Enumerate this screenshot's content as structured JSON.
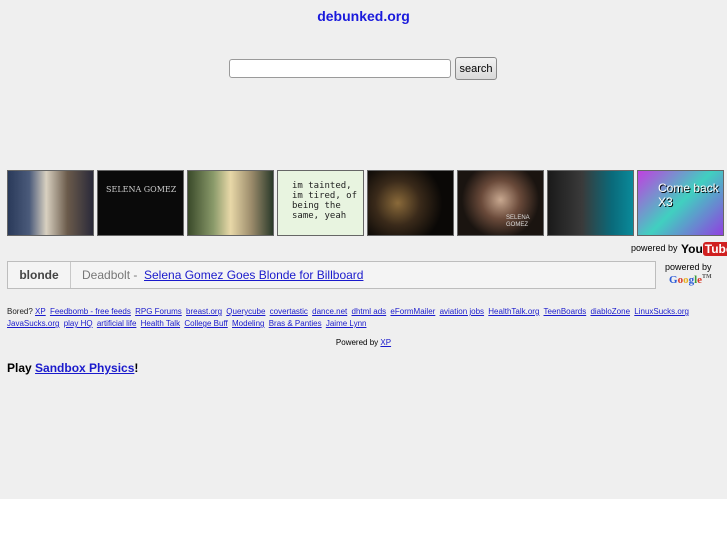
{
  "header": {
    "site_title": "debunked.org"
  },
  "search": {
    "value": "",
    "placeholder": "",
    "button_label": "search"
  },
  "thumbnails": [
    {
      "alt": "video-thumbnail-1",
      "overlay": ""
    },
    {
      "alt": "video-thumbnail-2",
      "overlay": "SELENA GOMEZ"
    },
    {
      "alt": "video-thumbnail-3",
      "overlay": ""
    },
    {
      "alt": "video-thumbnail-4",
      "overlay": "im tainted, im tired, of being the same, yeah"
    },
    {
      "alt": "video-thumbnail-5",
      "overlay": ""
    },
    {
      "alt": "video-thumbnail-6",
      "overlay": "SELENA GOMEZ"
    },
    {
      "alt": "video-thumbnail-7",
      "overlay": ""
    },
    {
      "alt": "video-thumbnail-8",
      "overlay": "Come back X3"
    }
  ],
  "youtube": {
    "powered_by": "powered by",
    "logo_you": "You",
    "logo_tube": "Tube"
  },
  "video": {
    "tag": "blonde",
    "author": "Deadbolt -",
    "title": "Selena Gomez Goes Blonde for Billboard"
  },
  "google": {
    "powered_by": "powered by",
    "logo": [
      "G",
      "o",
      "o",
      "g",
      "l",
      "e"
    ],
    "tm": "TM"
  },
  "links": {
    "intro": "Bored?",
    "items": [
      "XP",
      "Feedbomb - free feeds",
      "RPG Forums",
      "breast.org",
      "Querycube",
      "covertastic",
      "dance.net",
      "dhtml ads",
      "eFormMailer",
      "aviation jobs",
      "HealthTalk.org",
      "TeenBoards",
      "diabloZone",
      "LinuxSucks.org",
      "JavaSucks.org",
      "play HQ",
      "artificial life",
      "Health Talk",
      "College Buff",
      "Modeling",
      "Bras & Panties",
      "Jaime Lynn"
    ]
  },
  "footer": {
    "powered_text": "Powered by",
    "powered_link": "XP"
  },
  "play": {
    "prefix": "Play",
    "link": "Sandbox Physics",
    "suffix": "!"
  }
}
